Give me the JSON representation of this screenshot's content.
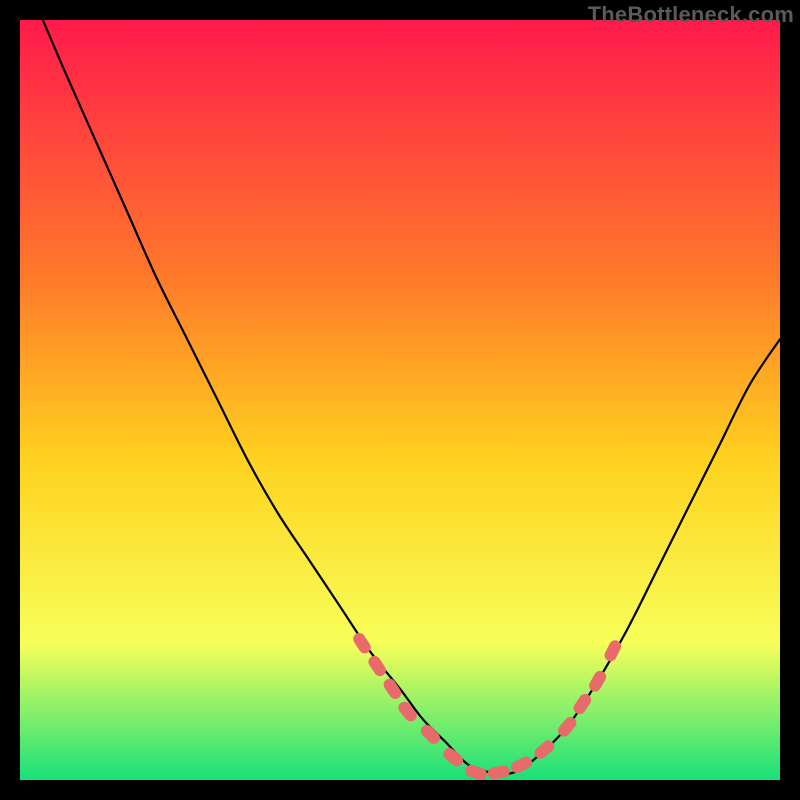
{
  "watermark": "TheBottleneck.com",
  "colors": {
    "gradient_top": "#ff1a4b",
    "gradient_mid1": "#ff7a2a",
    "gradient_mid2": "#ffd21f",
    "gradient_mid3": "#f7ff5a",
    "gradient_bottom": "#18e07a",
    "curve": "#000000",
    "marker": "#e86a6a",
    "frame": "#000000"
  },
  "chart_data": {
    "type": "line",
    "title": "",
    "xlabel": "",
    "ylabel": "",
    "xlim": [
      0,
      100
    ],
    "ylim": [
      0,
      100
    ],
    "grid": false,
    "legend": false,
    "series": [
      {
        "name": "bottleneck-curve",
        "x": [
          3,
          6,
          10,
          14,
          18,
          22,
          26,
          30,
          34,
          38,
          42,
          46,
          50,
          53,
          56,
          59,
          62,
          65,
          68,
          72,
          76,
          80,
          84,
          88,
          92,
          96,
          100
        ],
        "y": [
          100,
          93,
          84,
          75,
          66,
          58,
          50,
          42,
          35,
          29,
          23,
          17,
          12,
          8,
          5,
          2,
          1,
          1,
          3,
          7,
          13,
          20,
          28,
          36,
          44,
          52,
          58
        ]
      }
    ],
    "markers": {
      "name": "sample-points",
      "x": [
        45,
        47,
        49,
        51,
        54,
        57,
        60,
        63,
        66,
        69,
        72,
        74,
        76,
        78
      ],
      "y": [
        18,
        15,
        12,
        9,
        6,
        3,
        1,
        1,
        2,
        4,
        7,
        10,
        13,
        17
      ]
    }
  }
}
